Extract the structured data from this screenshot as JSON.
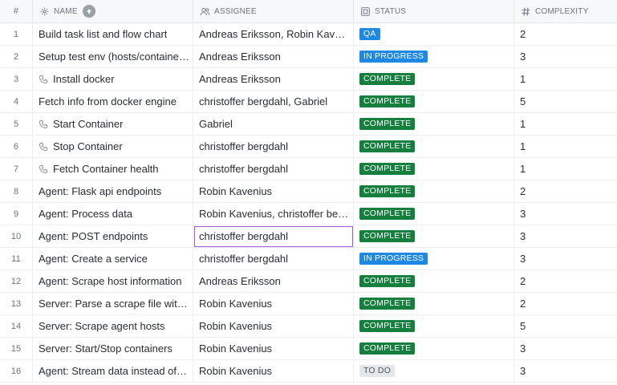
{
  "header": {
    "num_label": "#",
    "name_label": "NAME",
    "assignee_label": "ASSIGNEE",
    "status_label": "STATUS",
    "complexity_label": "COMPLEXITY"
  },
  "status_colors": {
    "QA": "#1e88e5",
    "IN PROGRESS": "#1e88e5",
    "COMPLETE": "#15803d",
    "TO DO": "#e5e7eb"
  },
  "rows": [
    {
      "num": "1",
      "name": "Build task list and flow chart",
      "assignee": "Andreas Eriksson, Robin Kavenius",
      "status": "QA",
      "complexity": "2",
      "subtask": false
    },
    {
      "num": "2",
      "name": "Setup test env (hosts/containers)",
      "assignee": "Andreas Eriksson",
      "status": "IN PROGRESS",
      "complexity": "3",
      "subtask": false
    },
    {
      "num": "3",
      "name": "Install docker",
      "assignee": "Andreas Eriksson",
      "status": "COMPLETE",
      "complexity": "1",
      "subtask": true
    },
    {
      "num": "4",
      "name": "Fetch info from docker engine",
      "assignee": "christoffer bergdahl, Gabriel",
      "status": "COMPLETE",
      "complexity": "5",
      "subtask": false
    },
    {
      "num": "5",
      "name": "Start Container",
      "assignee": "Gabriel",
      "status": "COMPLETE",
      "complexity": "1",
      "subtask": true
    },
    {
      "num": "6",
      "name": "Stop Container",
      "assignee": "christoffer bergdahl",
      "status": "COMPLETE",
      "complexity": "1",
      "subtask": true
    },
    {
      "num": "7",
      "name": "Fetch Container health",
      "assignee": "christoffer bergdahl",
      "status": "COMPLETE",
      "complexity": "1",
      "subtask": true
    },
    {
      "num": "8",
      "name": "Agent: Flask api endpoints",
      "assignee": "Robin Kavenius",
      "status": "COMPLETE",
      "complexity": "2",
      "subtask": false
    },
    {
      "num": "9",
      "name": "Agent: Process data",
      "assignee": "Robin Kavenius, christoffer bergdahl",
      "status": "COMPLETE",
      "complexity": "3",
      "subtask": false
    },
    {
      "num": "10",
      "name": "Agent: POST endpoints",
      "assignee": "christoffer bergdahl",
      "status": "COMPLETE",
      "complexity": "3",
      "subtask": false,
      "selected_assignee": true
    },
    {
      "num": "11",
      "name": "Agent: Create a service",
      "assignee": "christoffer bergdahl",
      "status": "IN PROGRESS",
      "complexity": "3",
      "subtask": false
    },
    {
      "num": "12",
      "name": "Agent: Scrape host information",
      "assignee": "Andreas Eriksson",
      "status": "COMPLETE",
      "complexity": "2",
      "subtask": false
    },
    {
      "num": "13",
      "name": "Server: Parse a scrape file with data",
      "assignee": "Robin Kavenius",
      "status": "COMPLETE",
      "complexity": "2",
      "subtask": false
    },
    {
      "num": "14",
      "name": "Server: Scrape agent hosts",
      "assignee": "Robin Kavenius",
      "status": "COMPLETE",
      "complexity": "5",
      "subtask": false
    },
    {
      "num": "15",
      "name": "Server: Start/Stop containers",
      "assignee": "Robin Kavenius",
      "status": "COMPLETE",
      "complexity": "3",
      "subtask": false
    },
    {
      "num": "16",
      "name": "Agent: Stream data instead of polling",
      "assignee": "Robin Kavenius",
      "status": "TO DO",
      "complexity": "3",
      "subtask": false
    }
  ]
}
